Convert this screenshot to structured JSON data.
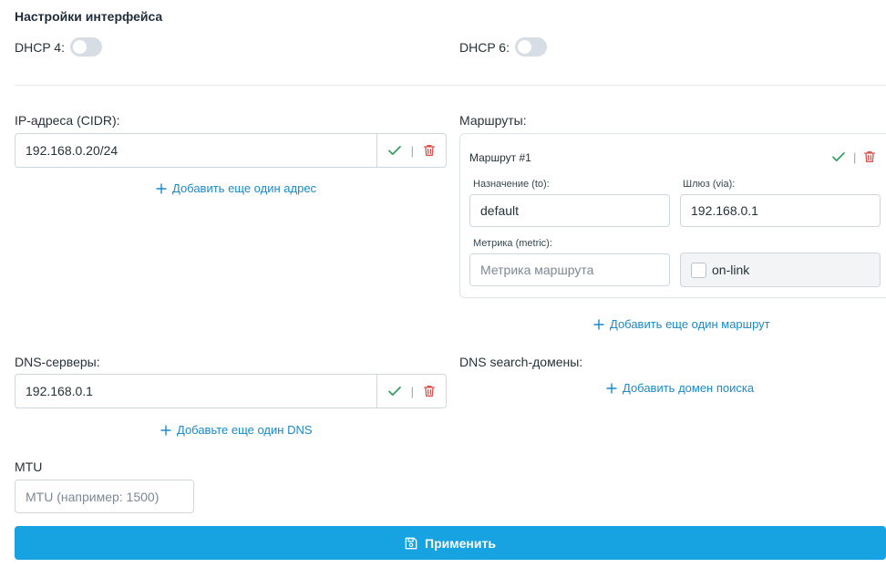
{
  "page": {
    "title": "Настройки интерфейса"
  },
  "dhcp": {
    "v4_label": "DHCP 4:",
    "v4_enabled": false,
    "v6_label": "DHCP 6:",
    "v6_enabled": false
  },
  "ip_addresses": {
    "label": "IP-адреса (CIDR):",
    "items": [
      "192.168.0.20/24"
    ],
    "add_label": "Добавить еще один адрес"
  },
  "routes": {
    "label": "Маршруты:",
    "items": [
      {
        "title": "Маршрут #1",
        "destination_label": "Назначение (to):",
        "destination_value": "default",
        "gateway_label": "Шлюз (via):",
        "gateway_value": "192.168.0.1",
        "metric_label": "Метрика (metric):",
        "metric_placeholder": "Метрика маршрута",
        "onlink_label": "on-link",
        "onlink_checked": false
      }
    ],
    "add_label": "Добавить еще один маршрут"
  },
  "dns_servers": {
    "label": "DNS-серверы:",
    "items": [
      "192.168.0.1"
    ],
    "add_label": "Добавьте еще один DNS"
  },
  "dns_search": {
    "label": "DNS search-домены:",
    "add_label": "Добавить домен поиска"
  },
  "mtu": {
    "label": "MTU",
    "placeholder": "MTU (например: 1500)"
  },
  "actions": {
    "apply_label": "Применить",
    "separator": "|"
  },
  "colors": {
    "accent": "#17a2e2",
    "link": "#1a8ac8",
    "confirm": "#2e9e5b",
    "delete": "#d9534f"
  },
  "icons": {
    "confirm": "check-icon",
    "delete": "trash-icon",
    "add": "plus-icon",
    "save": "floppy-disk-icon"
  }
}
